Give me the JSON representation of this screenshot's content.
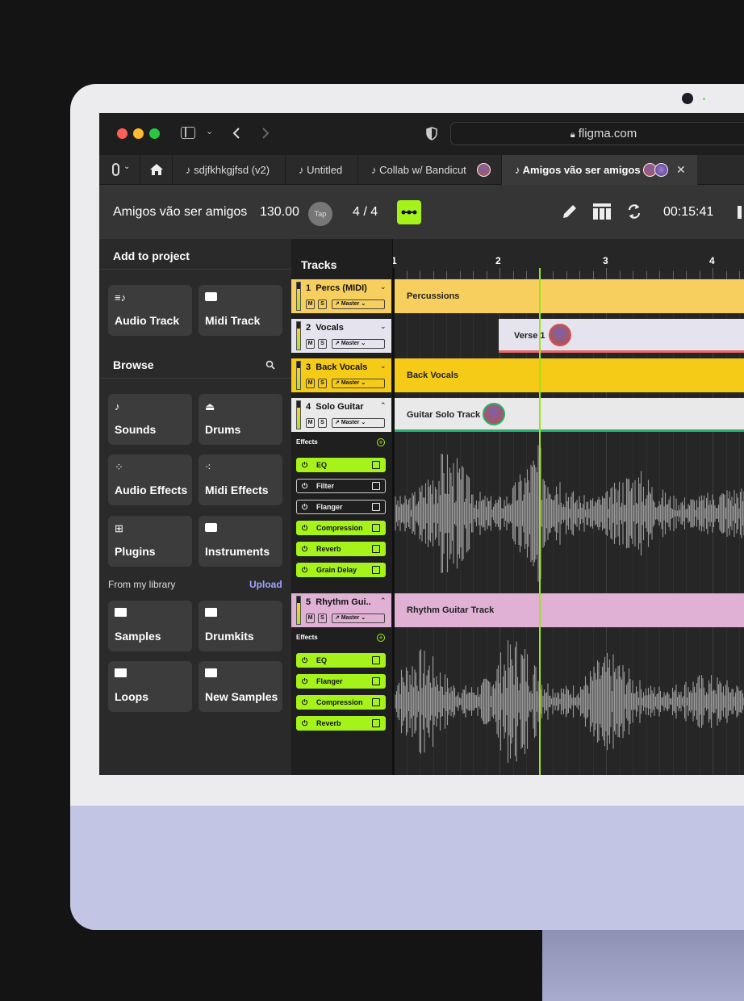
{
  "browser": {
    "url": "fligma.com",
    "tabs": [
      {
        "label": "sdjfkhkgjfsd (v2)"
      },
      {
        "label": "Untitled"
      },
      {
        "label": "Collab w/ Bandicut"
      },
      {
        "label": "Amigos vão ser amigos",
        "active": true
      }
    ]
  },
  "toolbar": {
    "project_name": "Amigos vão ser amigos",
    "bpm": "130.00",
    "tap": "Tap",
    "time_signature": "4 / 4",
    "time": "00:15:41"
  },
  "sidebar": {
    "add_to_project": "Add to project",
    "add_items": [
      "Audio Track",
      "Midi Track"
    ],
    "browse": "Browse",
    "browse_items": [
      "Sounds",
      "Drums",
      "Audio Effects",
      "Midi Effects",
      "Plugins",
      "Instruments"
    ],
    "from_library": "From my library",
    "upload": "Upload",
    "library_items": [
      "Samples",
      "Drumkits",
      "Loops",
      "New Samples"
    ]
  },
  "tracks_header": "Tracks",
  "ruler": [
    "1",
    "2",
    "3",
    "4"
  ],
  "tracks": [
    {
      "number": "1",
      "name": "Percs (MIDI)",
      "color": "#f7cf5e",
      "m": "M",
      "s": "S",
      "route": "Master",
      "clip": "Percussions"
    },
    {
      "number": "2",
      "name": "Vocals",
      "color": "#e4e3ee",
      "m": "M",
      "s": "S",
      "route": "Master",
      "clip": "Verse 1"
    },
    {
      "number": "3",
      "name": "Back Vocals",
      "color": "#f6cb18",
      "m": "M",
      "s": "S",
      "route": "Master",
      "clip": "Back Vocals"
    },
    {
      "number": "4",
      "name": "Solo Guitar",
      "color": "#e9e9e9",
      "m": "M",
      "s": "S",
      "route": "Master",
      "clip": "Guitar Solo Track"
    },
    {
      "number": "5",
      "name": "Rhythm Gui..",
      "color": "#e0b1d5",
      "m": "M",
      "s": "S",
      "route": "Master",
      "clip": "Rhythm Guitar Track"
    }
  ],
  "effects_label": "Effects",
  "solo_effects": [
    {
      "name": "EQ",
      "on": true
    },
    {
      "name": "Filter",
      "on": false
    },
    {
      "name": "Flanger",
      "on": false
    },
    {
      "name": "Compression",
      "on": true
    },
    {
      "name": "Reverb",
      "on": true
    },
    {
      "name": "Grain Delay",
      "on": true
    }
  ],
  "rhythm_effects": [
    {
      "name": "EQ",
      "on": true
    },
    {
      "name": "Flanger",
      "on": true
    },
    {
      "name": "Compression",
      "on": true
    },
    {
      "name": "Reverb",
      "on": true
    }
  ],
  "colors": {
    "accent": "#a6f21b",
    "playhead": "#9be61b"
  }
}
